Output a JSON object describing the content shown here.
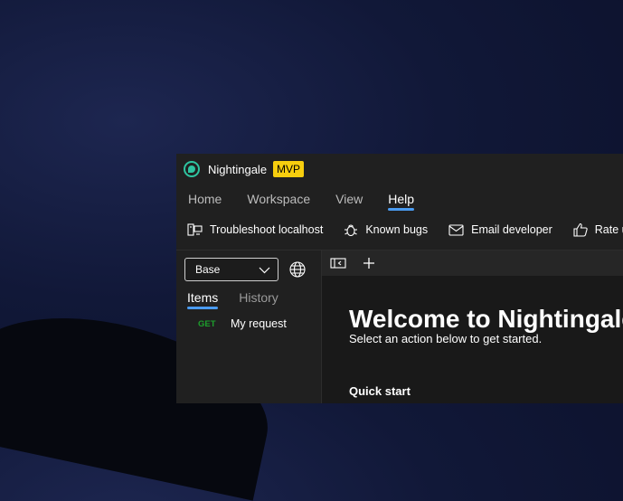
{
  "app": {
    "title": "Nightingale",
    "badge": "MVP"
  },
  "menu": {
    "tabs": [
      "Home",
      "Workspace",
      "View",
      "Help"
    ],
    "active": "Help"
  },
  "ribbon": {
    "troubleshoot": "Troubleshoot localhost",
    "known_bugs": "Known bugs",
    "email": "Email developer",
    "rate": "Rate us"
  },
  "sidebar": {
    "environment": "Base",
    "tabs": [
      "Items",
      "History"
    ],
    "requests": [
      {
        "method": "GET",
        "name": "My request"
      }
    ]
  },
  "main": {
    "welcome": "Welcome to Nightingale",
    "subtitle": "Select an action below to get started.",
    "quick_start": "Quick start"
  },
  "colors": {
    "accent": "#4a9bf0",
    "badge": "#f7ce0e",
    "get_method": "#1d9e2c",
    "logo": "#2ec4a0"
  },
  "icons": [
    "app-logo-icon",
    "computer-icon",
    "bug-icon",
    "mail-icon",
    "thumbs-up-icon",
    "chevron-down-icon",
    "globe-icon",
    "collapse-panel-icon",
    "plus-icon"
  ]
}
